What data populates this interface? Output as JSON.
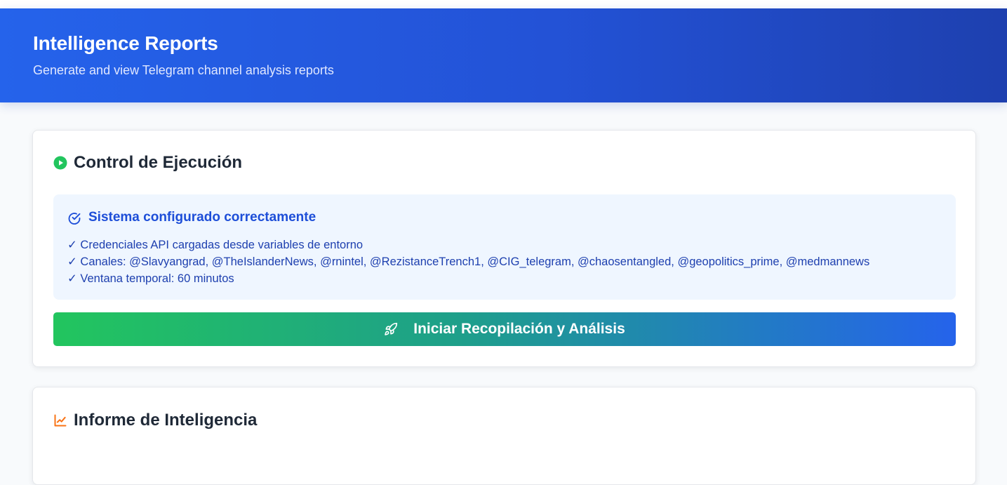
{
  "header": {
    "title": "Intelligence Reports",
    "subtitle": "Generate and view Telegram channel analysis reports"
  },
  "control": {
    "title": "Control de Ejecución",
    "title_icon": "play-circle-icon",
    "status": {
      "heading": "Sistema configurado correctamente",
      "heading_icon": "check-circle-icon",
      "lines": [
        "✓ Credenciales API cargadas desde variables de entorno",
        "✓ Canales: @Slavyangrad, @TheIslanderNews, @rnintel, @RezistanceTrench1, @CIG_telegram, @chaosentangled, @geopolitics_prime, @medmannews",
        "✓ Ventana temporal: 60 minutos"
      ]
    },
    "button": {
      "label": "Iniciar Recopilación y Análisis",
      "icon": "rocket-icon"
    }
  },
  "report": {
    "title": "Informe de Inteligencia",
    "title_icon": "trending-up-icon"
  },
  "colors": {
    "header_start": "#2563eb",
    "header_end": "#1e40af",
    "success_green": "#22c55e",
    "accent_blue": "#1d4ed8",
    "report_orange": "#f97316"
  }
}
